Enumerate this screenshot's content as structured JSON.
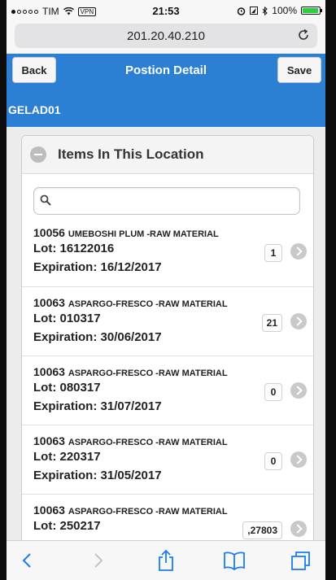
{
  "status_bar": {
    "carrier": "TIM",
    "vpn": "VPN",
    "time": "21:53",
    "battery": "100%"
  },
  "browser": {
    "url": "201.20.40.210"
  },
  "header": {
    "back_label": "Back",
    "title": "Postion Detail",
    "save_label": "Save",
    "location_code": "GELAD01"
  },
  "section": {
    "title": "Items In This Location",
    "search_placeholder": ""
  },
  "items": [
    {
      "code": "10056",
      "description": "UMEBOSHI PLUM -RAW MATERIAL",
      "lot": "Lot: 16122016",
      "expiration": "Expiration: 16/12/2017",
      "quantity": "1"
    },
    {
      "code": "10063",
      "description": "ASPARGO-FRESCO -RAW MATERIAL",
      "lot": "Lot: 010317",
      "expiration": "Expiration: 30/06/2017",
      "quantity": "21"
    },
    {
      "code": "10063",
      "description": "ASPARGO-FRESCO -RAW MATERIAL",
      "lot": "Lot: 080317",
      "expiration": "Expiration: 31/07/2017",
      "quantity": "0"
    },
    {
      "code": "10063",
      "description": "ASPARGO-FRESCO -RAW MATERIAL",
      "lot": "Lot: 220317",
      "expiration": "Expiration: 31/05/2017",
      "quantity": "0"
    },
    {
      "code": "10063",
      "description": "ASPARGO-FRESCO -RAW MATERIAL",
      "lot": "Lot: 250217",
      "expiration": "",
      "quantity": ",27803"
    }
  ],
  "colors": {
    "header_blue": "#2b7fd4",
    "toolbar_blue": "#1a7cf5"
  },
  "icons": [
    "wifi-icon",
    "reload-icon",
    "minus-icon",
    "search-icon",
    "chevron-right-icon",
    "back-arrow-icon",
    "forward-arrow-icon",
    "share-icon",
    "bookmarks-icon",
    "tabs-icon"
  ]
}
